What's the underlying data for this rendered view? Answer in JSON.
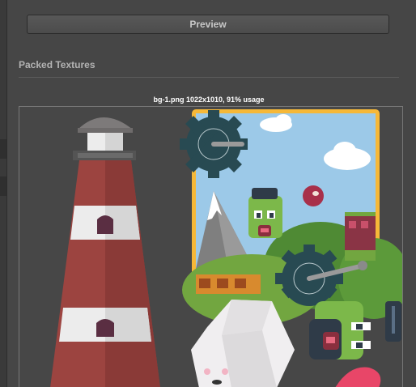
{
  "preview": {
    "label": "Preview"
  },
  "section": {
    "title": "Packed Textures"
  },
  "texture": {
    "caption": "bg-1.png 1022x1010, 91% usage"
  },
  "colors": {
    "panel_bg": "#464646",
    "selection_outline": "#f6b838",
    "sky": "#9cc9e8",
    "grass": "#72a640",
    "lighthouse_red": "#9c4440",
    "gear": "#284a52"
  }
}
